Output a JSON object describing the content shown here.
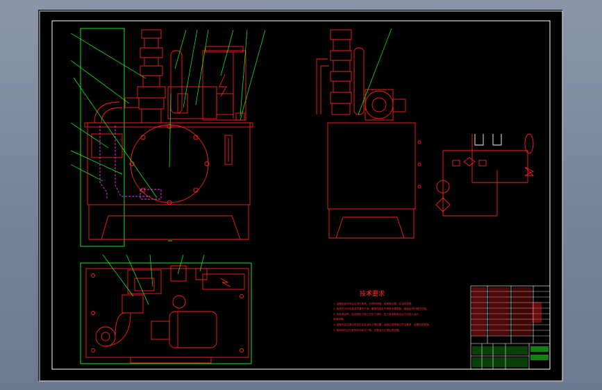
{
  "sheet": {
    "background": "#000000",
    "colors": {
      "outline": "#ffffff",
      "part": "#ff2020",
      "leader": "#20ff20",
      "hidden": "#ff30ff",
      "title_block": "#ffffff"
    }
  },
  "tech_requirements": {
    "title": "技术要求",
    "lines": [
      "1. 油箱制造完毕后应进行清洗，不得有焊渣、铁屑等杂物，并涂防锈漆。",
      "2. 各液压元件安装前须清洗干净，管路连接处不得有渗漏现象。组装后进行耐压试验。",
      "3. 系统调试时，溢流阀压力按工作压力调定，压力表读数稳定后方可投入运行。",
      "使用说明。",
      "4. 油箱内加注清洁的液压油至油标上限位置，油液过滤精度应符合要求，定期检查更换。",
      "5. 电机转向应与泵的转向标记一致，空载运行正常后再加载。"
    ]
  }
}
